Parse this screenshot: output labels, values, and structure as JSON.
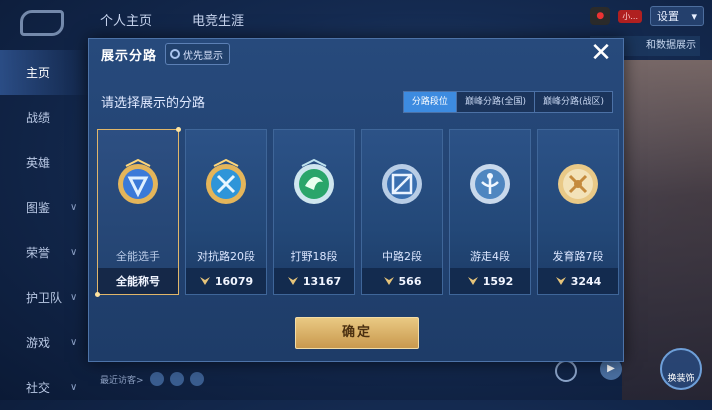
{
  "background": {
    "top_tabs": [
      "个人主页",
      "电竞生涯"
    ],
    "notify_text": "小...",
    "settings_label": "设置",
    "right_text": "和数据展示",
    "side_nav": [
      {
        "label": "主页",
        "active": true,
        "chevron": false
      },
      {
        "label": "战绩",
        "chevron": false
      },
      {
        "label": "英雄",
        "chevron": false
      },
      {
        "label": "图鉴",
        "chevron": true
      },
      {
        "label": "荣誉",
        "chevron": true
      },
      {
        "label": "护卫队",
        "chevron": true
      },
      {
        "label": "游戏",
        "chevron": true
      },
      {
        "label": "社交",
        "chevron": true
      }
    ],
    "recent_label": "最近访客>",
    "bottom_btn_label": "换装饰"
  },
  "modal": {
    "title": "展示分路",
    "priority_label": "优先显示",
    "close_symbol": "✕",
    "prompt": "请选择展示的分路",
    "filters": [
      {
        "label": "分路段位",
        "active": true
      },
      {
        "label": "巅峰分路(全国)",
        "active": false
      },
      {
        "label": "巅峰分路(战区)",
        "active": false
      }
    ],
    "cards": [
      {
        "name": "全能选手",
        "value": "全能称号",
        "selected": true,
        "icon": "all-round-badge-icon",
        "color": "#3b7ad8"
      },
      {
        "name": "对抗路20段",
        "value": "16079",
        "icon": "clash-lane-badge-icon",
        "color": "#2e95d9"
      },
      {
        "name": "打野18段",
        "value": "13167",
        "icon": "jungle-badge-icon",
        "color": "#2aa56a"
      },
      {
        "name": "中路2段",
        "value": "566",
        "icon": "mid-lane-badge-icon",
        "color": "#3a6fb0"
      },
      {
        "name": "游走4段",
        "value": "1592",
        "icon": "roam-badge-icon",
        "color": "#4f86c0"
      },
      {
        "name": "发育路7段",
        "value": "3244",
        "icon": "farm-lane-badge-icon",
        "color": "#c58a3c"
      }
    ],
    "confirm_label": "确定"
  }
}
